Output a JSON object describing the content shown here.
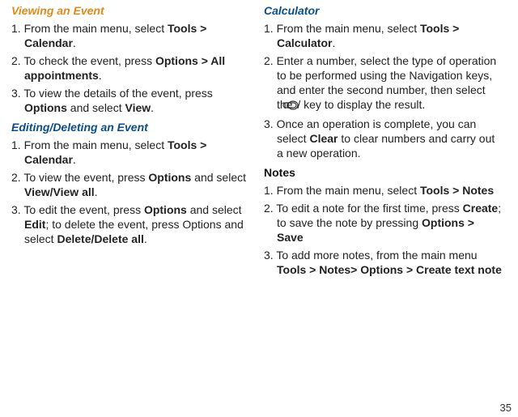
{
  "pageNumber": "35",
  "left": {
    "heading_view": "Viewing an Event",
    "view": [
      {
        "pre": "From the main menu, select ",
        "bold1": "Tools > Calendar",
        "post": "."
      },
      {
        "pre": "To check the event, press ",
        "bold1": "Options > All appointments",
        "post": "."
      },
      {
        "pre": "To view the details of the event, press ",
        "bold1": "Options",
        "mid": " and select ",
        "bold2": "View",
        "post": "."
      }
    ],
    "heading_edit": "Editing/Deleting an Event",
    "edit": [
      {
        "pre": "From the main menu, select ",
        "bold1": "Tools > Calendar",
        "post": "."
      },
      {
        "pre": "To view the event, press ",
        "bold1": "Options",
        "mid": " and select ",
        "bold2": "View/View all",
        "post": "."
      },
      {
        "pre": "To edit the event, press ",
        "bold1": "Options",
        "mid": " and select ",
        "bold2": "Edit",
        "mid2": "; to delete the event, press Options and select ",
        "bold3": "Delete/Delete all",
        "post": "."
      }
    ]
  },
  "right": {
    "heading_calc": "Calculator",
    "calc": [
      {
        "pre": "From the main menu, select ",
        "bold1": "Tools > Calculator",
        "post": "."
      },
      {
        "pre": "Enter a number, select the type of operation to be performed using the Navigation keys, and enter the second number, then select the ",
        "keyicons": true,
        "post": " key to display the result."
      },
      {
        "pre": "Once an operation is complete, you can select ",
        "bold1": "Clear",
        "post": " to clear numbers and carry out a new operation."
      }
    ],
    "heading_notes": "Notes",
    "notes": [
      {
        "pre": "From the main menu, select ",
        "bold1": "Tools > Notes"
      },
      {
        "pre": "To edit a note for the first time, press ",
        "bold1": "Create",
        "mid": "; to save the note by pressing ",
        "bold2": "Options > Save"
      },
      {
        "pre": "To add more notes, from the main menu ",
        "bold1": "Tools > Notes> Options > Create text note"
      }
    ]
  }
}
